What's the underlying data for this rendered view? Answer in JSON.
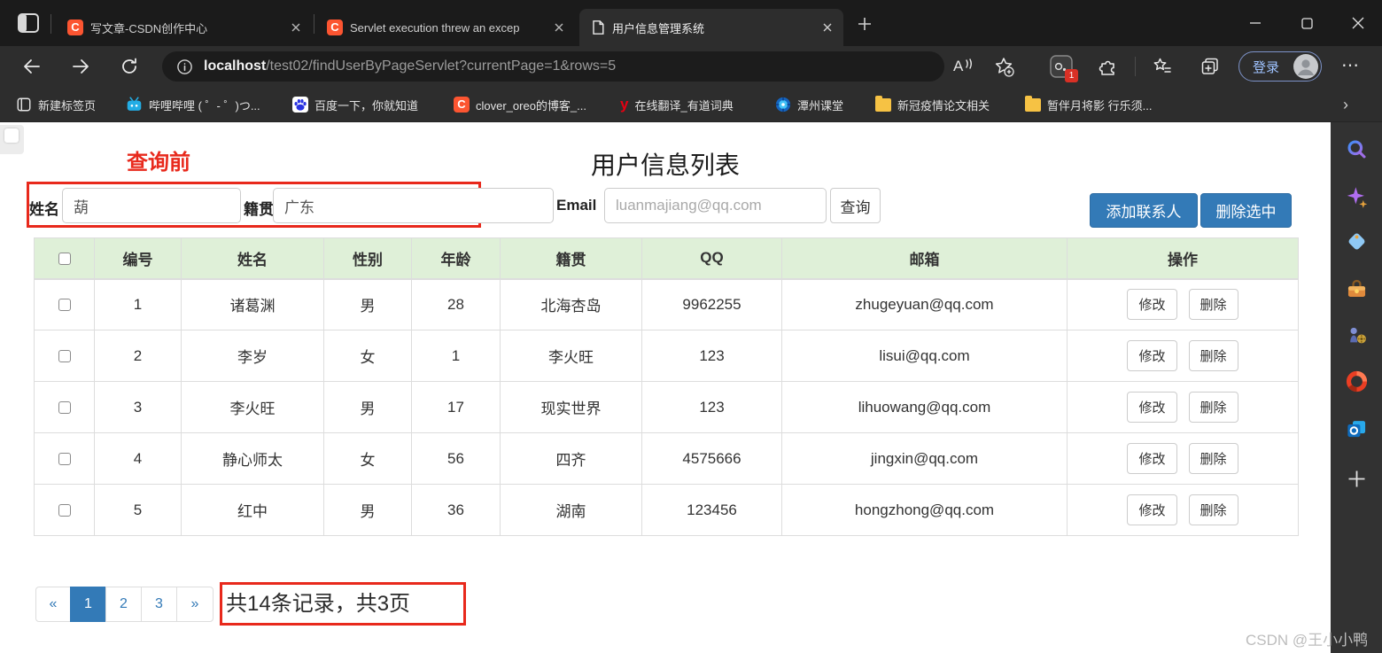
{
  "colors": {
    "accent_blue": "#337ab7",
    "annotation_red": "#e8291c",
    "table_header_green": "#dff0d8",
    "chrome_dark": "#1b1b1b",
    "toolbar_dark": "#2d2d2d"
  },
  "icons": {
    "csdn_glyph": "C",
    "youdao_glyph": "y",
    "read_aloud_glyph": "A",
    "more_glyph": "⋯",
    "bookmarks_overflow_glyph": "›"
  },
  "browser": {
    "tabs": [
      {
        "title": "写文章-CSDN创作中心"
      },
      {
        "title": "Servlet execution threw an excep"
      },
      {
        "title": "用户信息管理系统"
      }
    ],
    "address": {
      "host": "localhost",
      "path": "/test02/findUserByPageServlet?currentPage=1&rows=5"
    },
    "extension_badge": "1",
    "login_label": "登录",
    "bookmarks": [
      {
        "label": "新建标签页"
      },
      {
        "label": "哔哩哔哩 ( ゜- ゜)つ..."
      },
      {
        "label": "百度一下，你就知道"
      },
      {
        "label": "clover_oreo的博客_..."
      },
      {
        "label": "在线翻译_有道词典"
      },
      {
        "label": "潭州课堂"
      },
      {
        "label": "新冠疫情论文相关"
      },
      {
        "label": "暂伴月将影 行乐须..."
      }
    ],
    "sidebar_icons": [
      "search",
      "copilot",
      "shopping",
      "toolbox",
      "games",
      "office",
      "outlook",
      "add"
    ]
  },
  "page": {
    "annotation_query_before": "查询前",
    "title": "用户信息列表",
    "form": {
      "name_label": "姓名",
      "name_value": "葫",
      "origin_label": "籍贯",
      "origin_value": "广东",
      "email_label": "Email",
      "email_placeholder": "luanmajiang@qq.com",
      "query_button": "查询",
      "add_button": "添加联系人",
      "delete_selected_button": "删除选中"
    },
    "table": {
      "headers": [
        "编号",
        "姓名",
        "性别",
        "年龄",
        "籍贯",
        "QQ",
        "邮箱",
        "操作"
      ],
      "edit_button": "修改",
      "delete_button": "删除",
      "rows": [
        {
          "id": "1",
          "name": "诸葛渊",
          "gender": "男",
          "age": "28",
          "origin": "北海杏岛",
          "qq": "9962255",
          "email": "zhugeyuan@qq.com"
        },
        {
          "id": "2",
          "name": "李岁",
          "gender": "女",
          "age": "1",
          "origin": "李火旺",
          "qq": "123",
          "email": "lisui@qq.com"
        },
        {
          "id": "3",
          "name": "李火旺",
          "gender": "男",
          "age": "17",
          "origin": "现实世界",
          "qq": "123",
          "email": "lihuowang@qq.com"
        },
        {
          "id": "4",
          "name": "静心师太",
          "gender": "女",
          "age": "56",
          "origin": "四齐",
          "qq": "4575666",
          "email": "jingxin@qq.com"
        },
        {
          "id": "5",
          "name": "红中",
          "gender": "男",
          "age": "36",
          "origin": "湖南",
          "qq": "123456",
          "email": "hongzhong@qq.com"
        }
      ]
    },
    "pagination": {
      "prev": "«",
      "pages": [
        "1",
        "2",
        "3"
      ],
      "active_page": "1",
      "next": "»",
      "summary": "共14条记录，共3页"
    },
    "watermark": "CSDN @王小小鸭"
  }
}
